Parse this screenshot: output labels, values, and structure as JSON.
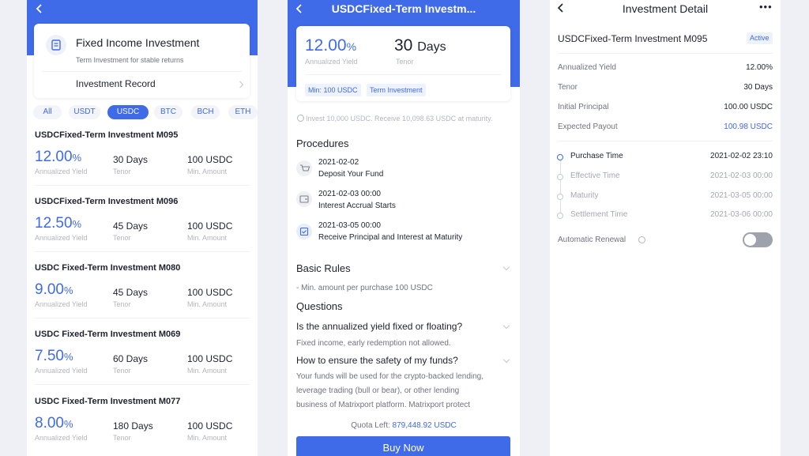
{
  "screen1": {
    "back_icon": "chevron-left-icon",
    "card_title": "Fixed Income Investment",
    "card_subtitle": "Term Investment for stable returns",
    "record_label": "Investment Record",
    "tabs": [
      "All",
      "USDT",
      "USDC",
      "BTC",
      "BCH",
      "ETH"
    ],
    "active_tab": "USDC",
    "labels": {
      "yield": "Annualized Yield",
      "tenor": "Tenor",
      "min": "Min. Amount"
    },
    "products": [
      {
        "title": "USDCFixed-Term Investment M095",
        "yield": "12.00",
        "pct": "%",
        "tenor": "30 Days",
        "min": "100 USDC"
      },
      {
        "title": "USDCFixed-Term Investment M096",
        "yield": "12.50",
        "pct": "%",
        "tenor": "45 Days",
        "min": "100 USDC"
      },
      {
        "title": "USDC Fixed-Term Investment M080",
        "yield": "9.00",
        "pct": "%",
        "tenor": "45 Days",
        "min": "100 USDC"
      },
      {
        "title": "USDC Fixed-Term Investment M069",
        "yield": "7.50",
        "pct": "%",
        "tenor": "60 Days",
        "min": "100 USDC"
      },
      {
        "title": "USDC Fixed-Term Investment M077",
        "yield": "8.00",
        "pct": "%",
        "tenor": "180 Days",
        "min": "100 USDC"
      }
    ]
  },
  "screen2": {
    "title": "USDCFixed-Term Investm...",
    "yield": "12.00",
    "pct": "%",
    "yield_label": "Annualized Yield",
    "tenor_num": "30",
    "tenor_unit": "Days",
    "tenor_label": "Tenor",
    "tags": [
      "Min: 100 USDC",
      "Term Investment"
    ],
    "example": "Invest 10,000 USDC. Receive 10,098.63 USDC at maturity.",
    "procedures_title": "Procedures",
    "procedures": [
      {
        "date": "2021-02-02",
        "text": "Deposit Your Fund"
      },
      {
        "date": "2021-02-03 00:00",
        "text": "Interest Accrual Starts"
      },
      {
        "date": "2021-03-05 00:00",
        "text": "Receive Principal and Interest at Maturity"
      }
    ],
    "rules_title": "Basic Rules",
    "rule": "- Min. amount per purchase 100 USDC",
    "questions_title": "Questions",
    "q1": "Is the annualized yield fixed or floating?",
    "a1": "Fixed income, early redemption not allowed.",
    "q2": "How to ensure the safety of my funds?",
    "a2_lines": [
      "Your funds will be used for the crypto-backed lending,",
      "leverage trading (bull or bear), or other lending",
      "business of Matrixport platform. Matrixport protect"
    ],
    "quota_label": "Quota Left:",
    "quota_value": "879,448.92 USDC",
    "buy_label": "Buy Now"
  },
  "screen3": {
    "title": "Investment Detail",
    "more": "•••",
    "product": "USDCFixed-Term Investment M095",
    "status": "Active",
    "rows": [
      {
        "label": "Annualized Yield",
        "value": "12.00%"
      },
      {
        "label": "Tenor",
        "value": "30 Days"
      },
      {
        "label": "Initial Principal",
        "value": "100.00 USDC"
      },
      {
        "label": "Expected Payout",
        "value": "100.98 USDC"
      }
    ],
    "timeline": [
      {
        "label": "Purchase Time",
        "value": "2021-02-02 23:10"
      },
      {
        "label": "Effective Time",
        "value": "2021-02-03 00:00"
      },
      {
        "label": "Maturity",
        "value": "2021-03-05 00:00"
      },
      {
        "label": "Settlement Time",
        "value": "2021-03-06 00:00"
      }
    ],
    "renewal_label": "Automatic Renewal",
    "renewal_on": false
  },
  "colors": {
    "accent": "#3f6ae8",
    "muted": "#a4a8b3",
    "text": "#1e2230"
  }
}
